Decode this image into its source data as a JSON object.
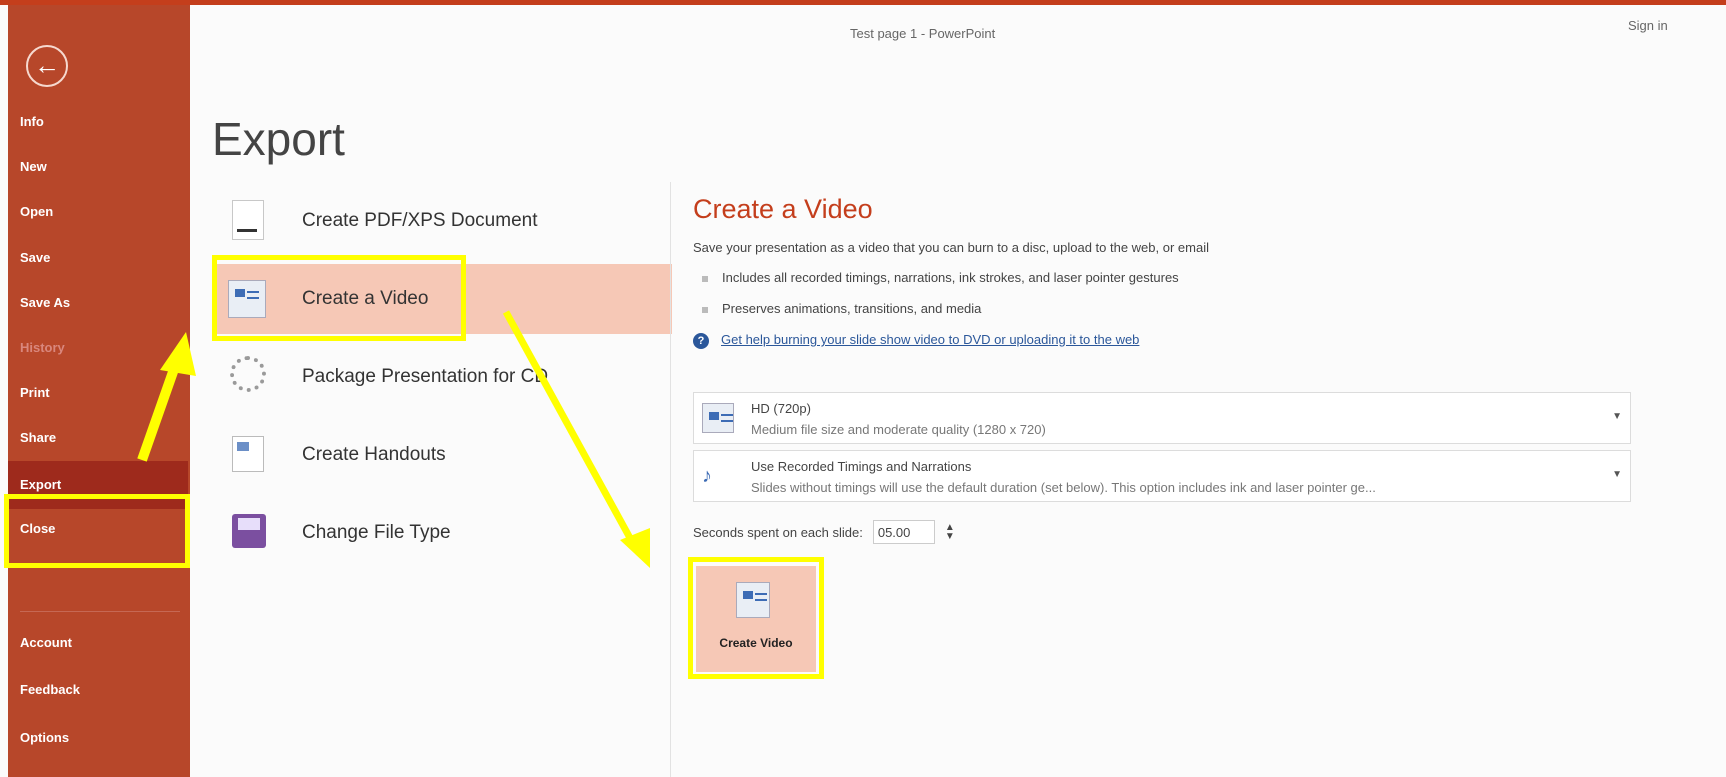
{
  "window": {
    "title": "Test page 1 - PowerPoint",
    "sign_in": "Sign in"
  },
  "sidebar": {
    "back_icon": "arrow-left-circle-icon",
    "items": [
      {
        "label": "Info",
        "state": "normal"
      },
      {
        "label": "New",
        "state": "normal"
      },
      {
        "label": "Open",
        "state": "normal"
      },
      {
        "label": "Save",
        "state": "normal"
      },
      {
        "label": "Save As",
        "state": "normal"
      },
      {
        "label": "History",
        "state": "disabled"
      },
      {
        "label": "Print",
        "state": "normal"
      },
      {
        "label": "Share",
        "state": "normal"
      },
      {
        "label": "Export",
        "state": "active"
      },
      {
        "label": "Close",
        "state": "normal"
      },
      {
        "label": "Account",
        "state": "normal"
      },
      {
        "label": "Feedback",
        "state": "normal"
      },
      {
        "label": "Options",
        "state": "normal"
      }
    ]
  },
  "page_title": "Export",
  "export_options": [
    {
      "label": "Create PDF/XPS Document",
      "icon": "pdf-document-icon"
    },
    {
      "label": "Create a Video",
      "icon": "video-icon",
      "selected": true
    },
    {
      "label": "Package Presentation for CD",
      "icon": "cd-icon"
    },
    {
      "label": "Create Handouts",
      "icon": "handouts-icon"
    },
    {
      "label": "Change File Type",
      "icon": "file-type-icon"
    }
  ],
  "create_video": {
    "title": "Create a Video",
    "description": "Save your presentation as a video that you can burn to a disc, upload to the web, or email",
    "bullets": [
      "Includes all recorded timings, narrations, ink strokes, and laser pointer gestures",
      "Preserves animations, transitions, and media"
    ],
    "help_link": "Get help burning your slide show video to DVD or uploading it to the web",
    "quality": {
      "main": "HD (720p)",
      "sub": "Medium file size and moderate quality (1280 x 720)"
    },
    "timings": {
      "main": "Use Recorded Timings and Narrations",
      "sub": "Slides without timings will use the default duration (set below). This option includes ink and laser pointer ge..."
    },
    "seconds_label": "Seconds spent on each slide:",
    "seconds_value": "05.00",
    "button_label": "Create Video"
  },
  "annotation_color": "#ffff00",
  "accent_color": "#b7472a"
}
